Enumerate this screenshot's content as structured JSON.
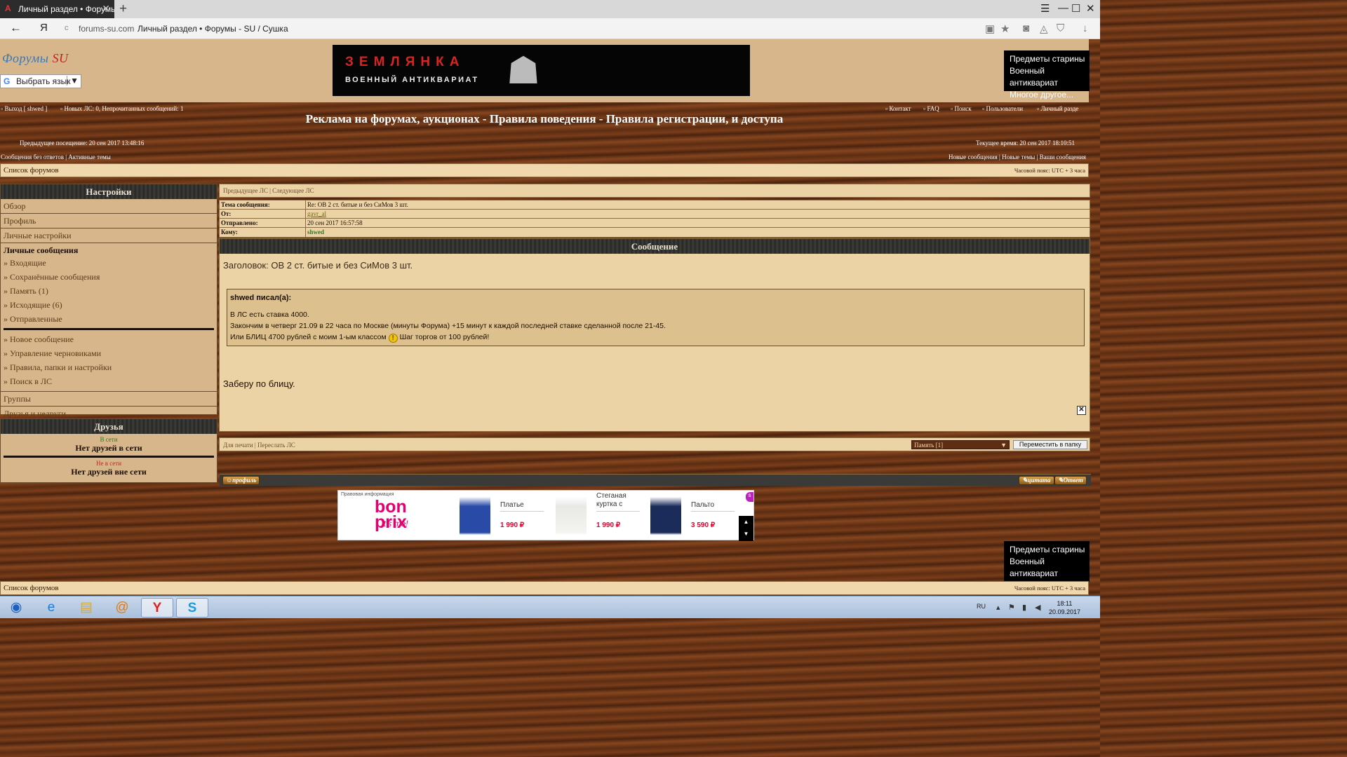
{
  "browser": {
    "tab_title": "Личный раздел • Форумы",
    "tab_favicon": "А",
    "close_tab": "✕",
    "new_tab": "+",
    "host": "forums-su.com",
    "page_title": "Личный раздел • Форумы - SU / Сушка",
    "yandex": "Я"
  },
  "header": {
    "logo_part1": "Форумы ",
    "logo_part2": "SU",
    "lang_select": "Выбрать язык",
    "banner_line1": "ЗЕМЛЯНКА",
    "banner_line2": "ВОЕННЫЙ АНТИКВАРИАТ",
    "side_ad": {
      "line1": "Предметы старины",
      "line2": "Военный антиквариат",
      "line3": "Многое другое..."
    }
  },
  "topbar": {
    "logout": "Выход [ shwed ]",
    "pm_status": "Новых ЛС: 0, Непрочитанных сообщений: 1",
    "links": [
      "Контакт",
      "FAQ",
      "Поиск",
      "Пользователи",
      "Личный разде"
    ]
  },
  "board_title": "Реклама на форумах, аукционах - Правила поведения - Правила регистрации, и доступа",
  "visits": {
    "last_visit": "Предыдущее посещение: 20 сен 2017 13:48:16",
    "current_time": "Текущее время: 20 сен 2017 18:10:51"
  },
  "quicklinks": {
    "left": "Сообщения без ответов | Активные темы",
    "right": "Новые сообщения | Новые темы | Ваши сообщения"
  },
  "breadcrumb": {
    "label": "Список форумов",
    "timezone": "Часовой пояс: UTC + 3 часа"
  },
  "sidebar": {
    "settings_title": "Настройки",
    "items": [
      "Обзор",
      "Профиль",
      "Личные настройки"
    ],
    "pm_title": "Личные сообщения",
    "pm_items": [
      "» Входящие",
      "» Сохранённые сообщения",
      "» Память (1)",
      "» Исходящие (6)",
      "» Отправленные"
    ],
    "pm_actions": [
      "» Новое сообщение",
      "» Управление черновиками",
      "» Правила, папки и настройки",
      "» Поиск в ЛС"
    ],
    "groups": "Группы",
    "friends_foes": "Друзья и недруги",
    "friends_title": "Друзья",
    "online_label": "В сети",
    "online_none": "Нет друзей в сети",
    "offline_label": "Не в сети",
    "offline_none": "Нет друзей вне сети"
  },
  "pm": {
    "nav": "Предыдущее ЛС | Следующее ЛС",
    "subject_label": "Тема сообщения:",
    "subject": "Re: ОВ 2 ст. битые и без СиМов 3 шт.",
    "from_label": "От:",
    "from": "gavr_al",
    "sent_label": "Отправлено:",
    "sent": "20 сен 2017 16:57:58",
    "to_label": "Кому:",
    "to": "shwed",
    "message_title": "Сообщение",
    "heading": "Заголовок: ОВ 2 ст. битые и без СиМов 3 шт.",
    "quote_author": "shwed писал(а):",
    "quote_line1": "В ЛС есть ставка 4000.",
    "quote_line2": "Закончим в четверг 21.09 в 22 часа по Москве (минуты Форума) +15 минут к каждой последней ставке сделанной после 21-45.",
    "quote_line3a": "Или БЛИЦ 4700 рублей с моим 1-ым классом",
    "quote_line3b": "Шаг торгов от 100 рублей!",
    "smile": "!",
    "body": "Заберу по блицу.",
    "close": "✕",
    "profile_btn": "профиль",
    "quote_btn": "цитата",
    "reply_btn": "Ответ",
    "print_forward": "Для печати | Переслать ЛС",
    "folder_select": "Память [1]",
    "move_btn": "Переместить в папку"
  },
  "bottom_ad": {
    "legal": "Правовая информация",
    "logo1": "bon\nprix",
    "logo2": "it's me!",
    "products": [
      {
        "name": "Платье",
        "price": "1 990 ₽"
      },
      {
        "name": "Стеганая куртка с",
        "price": "1 990 ₽"
      },
      {
        "name": "Пальто",
        "price": "3 590 ₽"
      }
    ]
  },
  "taskbar": {
    "lang": "RU",
    "time": "18:11",
    "date": "20.09.2017"
  }
}
